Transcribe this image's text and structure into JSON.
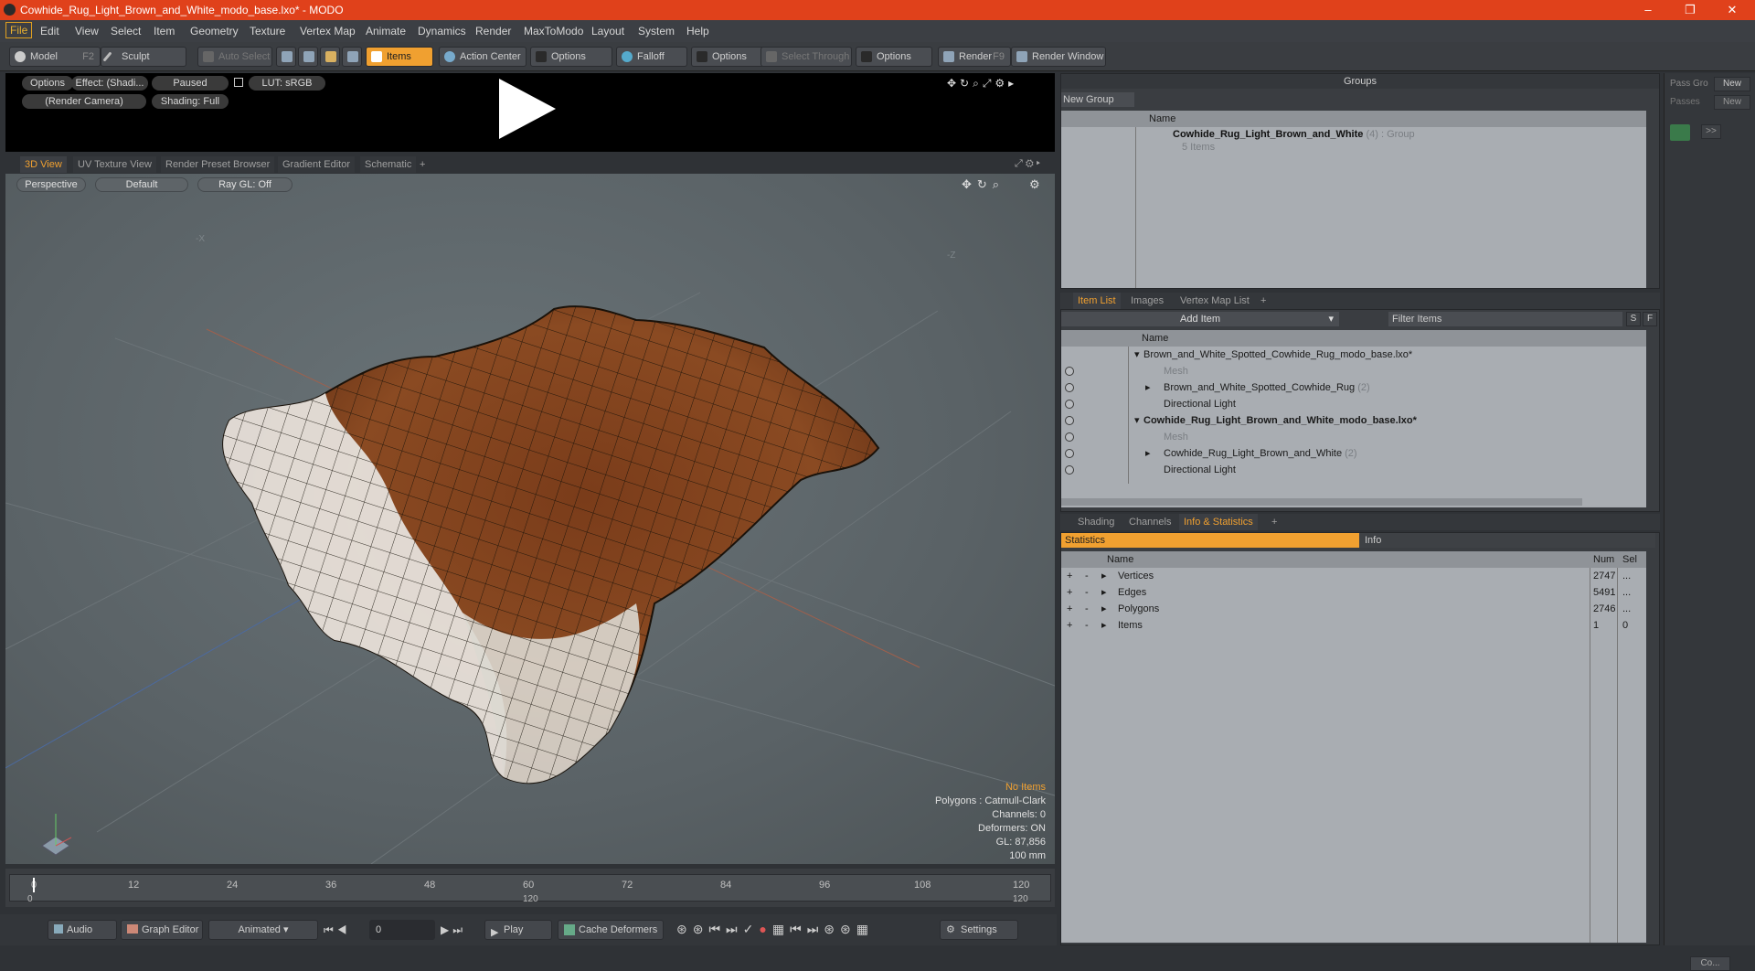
{
  "title": "Cowhide_Rug_Light_Brown_and_White_modo_base.lxo* - MODO",
  "menu": [
    "File",
    "Edit",
    "View",
    "Select",
    "Item",
    "Geometry",
    "Texture",
    "Vertex Map",
    "Animate",
    "Dynamics",
    "Render",
    "MaxToModo",
    "Layout",
    "System",
    "Help"
  ],
  "toolbar": {
    "model": "Model",
    "model_key": "F2",
    "sculpt": "Sculpt",
    "auto_select": "Auto Select",
    "items": "Items",
    "action_center": "Action Center",
    "options1": "Options",
    "falloff": "Falloff",
    "options2": "Options",
    "select_through": "Select Through",
    "options3": "Options",
    "render": "Render",
    "render_key": "F9",
    "render_window": "Render Window"
  },
  "preview": {
    "options": "Options",
    "effect": "Effect: (Shadi...",
    "paused": "Paused",
    "lut": "LUT: sRGB",
    "camera": "(Render Camera)",
    "shading": "Shading: Full"
  },
  "view_tabs": [
    "3D View",
    "UV Texture View",
    "Render Preset Browser",
    "Gradient Editor",
    "Schematic",
    "+"
  ],
  "viewport": {
    "perspective": "Perspective",
    "default": "Default",
    "raygl": "Ray GL: Off",
    "axis_x": "-X",
    "axis_z": "-Z",
    "no_items": "No Items",
    "polygons": "Polygons : Catmull-Clark",
    "channels": "Channels: 0",
    "deformers": "Deformers: ON",
    "gl": "GL: 87,856",
    "scale": "100 mm"
  },
  "timeline": {
    "ticks": [
      "0",
      "12",
      "24",
      "36",
      "48",
      "60",
      "72",
      "84",
      "96",
      "108",
      "120"
    ],
    "start": "0",
    "mid": "120",
    "end": "120"
  },
  "bottom": {
    "audio": "Audio",
    "graph_editor": "Graph Editor",
    "animated": "Animated",
    "frame": "0",
    "play": "Play",
    "cache": "Cache Deformers",
    "settings": "Settings"
  },
  "groups": {
    "header": "Groups",
    "new_group": "New Group",
    "col_name": "Name",
    "group_name": "Cowhide_Rug_Light_Brown_and_White",
    "group_count": "(4)",
    "group_type": ": Group",
    "group_items": "5 Items"
  },
  "side": {
    "pass_group": "Pass Gro",
    "new1": "New",
    "passes": "Passes",
    "new2": "New",
    "co": "Co..."
  },
  "item_tabs": [
    "Item List",
    "Images",
    "Vertex Map List",
    "+"
  ],
  "item_list": {
    "add_item": "Add Item",
    "filter": "Filter Items",
    "s": "S",
    "f": "F",
    "col_name": "Name",
    "rows": [
      {
        "label": "Brown_and_White_Spotted_Cowhide_Rug_modo_base.lxo*",
        "count": "",
        "style": "scene"
      },
      {
        "label": "Mesh",
        "count": "",
        "style": "dim"
      },
      {
        "label": "Brown_and_White_Spotted_Cowhide_Rug",
        "count": "(2)",
        "style": "item"
      },
      {
        "label": "Directional Light",
        "count": "",
        "style": "light"
      },
      {
        "label": "Cowhide_Rug_Light_Brown_and_White_modo_base.lxo*",
        "count": "",
        "style": "scene-bold"
      },
      {
        "label": "Mesh",
        "count": "",
        "style": "dim"
      },
      {
        "label": "Cowhide_Rug_Light_Brown_and_White",
        "count": "(2)",
        "style": "item"
      },
      {
        "label": "Directional Light",
        "count": "",
        "style": "light"
      }
    ]
  },
  "info_tabs": [
    "Shading",
    "Channels",
    "Info & Statistics",
    "+"
  ],
  "statistics": {
    "tab_stats": "Statistics",
    "tab_info": "Info",
    "col_name": "Name",
    "col_num": "Num",
    "col_sel": "Sel",
    "rows": [
      {
        "name": "Vertices",
        "num": "2747",
        "sel": "..."
      },
      {
        "name": "Edges",
        "num": "5491",
        "sel": "..."
      },
      {
        "name": "Polygons",
        "num": "2746",
        "sel": "..."
      },
      {
        "name": "Items",
        "num": "1",
        "sel": "0"
      }
    ]
  },
  "colors": {
    "accent": "#f0a030",
    "titlebar": "#e0411b"
  }
}
